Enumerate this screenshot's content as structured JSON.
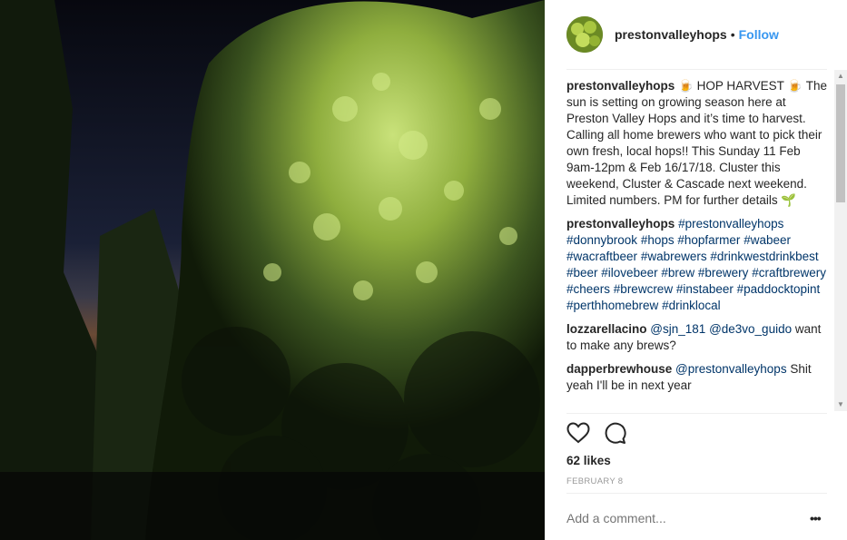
{
  "post": {
    "username": "preston­valleyhops",
    "follow_label": "Follow",
    "separator": "•"
  },
  "comments": [
    {
      "user": "prestonvalleyhops",
      "text": "🍺 HOP HARVEST 🍺 The sun is setting on growing season here at Preston Valley Hops and it’s time to harvest. Calling all home brewers who want to pick their own fresh, local hops!! This Sunday 11 Feb 9am-12pm & Feb 16/17/18. Cluster this weekend, Cluster & Cascade next weekend. Limited numbers. PM for further details 🌱"
    },
    {
      "user": "prestonvalleyhops",
      "hashtags": [
        "#prestonvalleyhops",
        "#donnybrook",
        "#hops",
        "#hopfarmer",
        "#wabeer",
        "#wacraftbeer",
        "#wabrewers",
        "#drinkwestdrinkbest",
        "#beer",
        "#ilovebeer",
        "#brew",
        "#brewery",
        "#craftbrewery",
        "#cheers",
        "#brewcrew",
        "#instabeer",
        "#paddocktopint",
        "#perthhomebrew",
        "#drinklocal"
      ]
    },
    {
      "user": "lozzarellacino",
      "mentions": [
        "@sjn_181",
        "@de3vo_guido"
      ],
      "text": "want to make any brews?"
    },
    {
      "user": "dapperbrewhouse",
      "mentions": [
        "@prestonvalleyhops"
      ],
      "text": "Shit yeah I'll be in next year"
    }
  ],
  "likes": "62 likes",
  "date": "FEBRUARY 8",
  "add_comment_placeholder": "Add a comment...",
  "more_label": "•••",
  "icons": [
    "heart-icon",
    "comment-icon"
  ]
}
